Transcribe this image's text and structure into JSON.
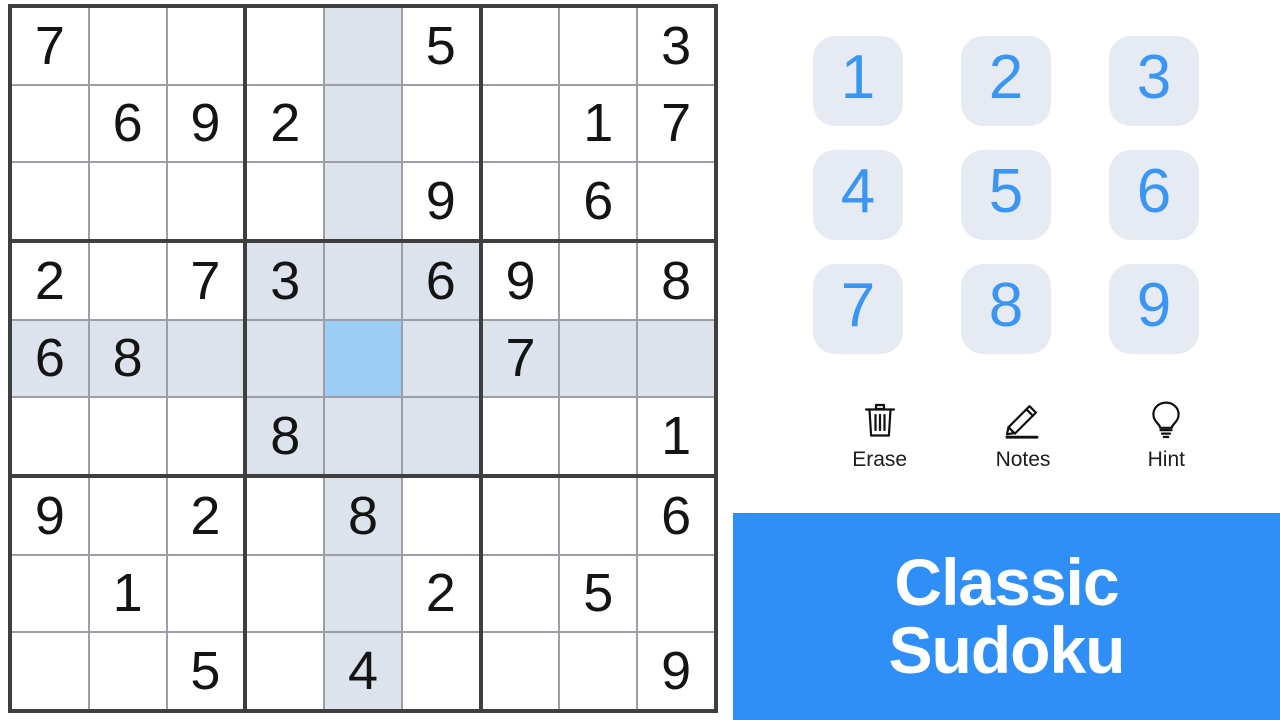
{
  "app": {
    "name": "Classic Sudoku"
  },
  "board": {
    "rows": 9,
    "cols": 9,
    "selected": {
      "row": 5,
      "col": 5
    },
    "colors": {
      "cell_bg": "#ffffff",
      "highlight_bg": "#dde3ec",
      "selected_bg": "#9ccdf5",
      "thick_line": "#3f3f3f",
      "thin_line": "#9b9fa5",
      "digit": "#141414"
    },
    "cells": [
      [
        "7",
        "",
        "",
        "",
        "",
        "5",
        "",
        "",
        "3"
      ],
      [
        "",
        "6",
        "9",
        "2",
        "",
        "",
        "",
        "1",
        "7"
      ],
      [
        "",
        "",
        "",
        "",
        "",
        "9",
        "",
        "6",
        ""
      ],
      [
        "2",
        "",
        "7",
        "3",
        "",
        "6",
        "9",
        "",
        "8"
      ],
      [
        "6",
        "8",
        "",
        "",
        "",
        "",
        "7",
        "",
        ""
      ],
      [
        "",
        "",
        "",
        "8",
        "",
        "",
        "",
        "",
        "1"
      ],
      [
        "9",
        "",
        "2",
        "",
        "8",
        "",
        "",
        "",
        "6"
      ],
      [
        "",
        "1",
        "",
        "",
        "",
        "2",
        "",
        "5",
        ""
      ],
      [
        "",
        "",
        "5",
        "",
        "4",
        "",
        "",
        "",
        "9"
      ]
    ]
  },
  "numpad": {
    "keys": [
      "1",
      "2",
      "3",
      "4",
      "5",
      "6",
      "7",
      "8",
      "9"
    ],
    "key_color": "#3b95f3",
    "key_bg": "#e6ebf3"
  },
  "actions": [
    {
      "label": "Erase",
      "icon": "trash-icon"
    },
    {
      "label": "Notes",
      "icon": "pencil-icon"
    },
    {
      "label": "Hint",
      "icon": "lightbulb-icon"
    }
  ],
  "banner": {
    "line1": "Classic",
    "line2": "Sudoku",
    "bg": "#2f8ff7",
    "text_color": "#ffffff"
  }
}
